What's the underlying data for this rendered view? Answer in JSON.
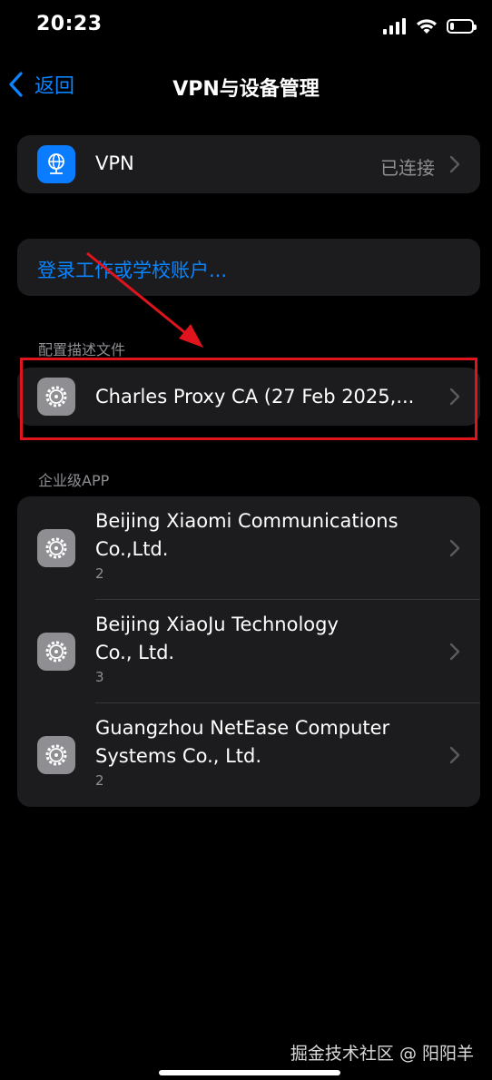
{
  "status_bar": {
    "time": "20:23",
    "battery_level": 0.2
  },
  "nav": {
    "back_label": "返回",
    "title": "VPN与设备管理"
  },
  "vpn_row": {
    "label": "VPN",
    "value": "已连接",
    "icon": "vpn-globe-icon"
  },
  "account_row": {
    "label": "登录工作或学校账户..."
  },
  "profiles_section": {
    "header": "配置描述文件",
    "items": [
      {
        "label": "Charles Proxy CA (27 Feb 2025,...",
        "icon": "settings-gear-icon"
      }
    ]
  },
  "enterprise_section": {
    "header": "企业级APP",
    "items": [
      {
        "name_line1": "Beijing Xiaomi Communications",
        "name_line2": "Co.,Ltd.",
        "count": "2"
      },
      {
        "name_line1": "Beijing XiaoJu Technology",
        "name_line2": "Co., Ltd.",
        "count": "3"
      },
      {
        "name_line1": "Guangzhou NetEase Computer",
        "name_line2": "Systems Co., Ltd.",
        "count": "2"
      }
    ]
  },
  "watermark": "掘金技术社区 @ 阳阳羊",
  "colors": {
    "background": "#000000",
    "group_background": "#1c1c1e",
    "accent_blue": "#0a84ff",
    "secondary_text": "#8e8e93",
    "annotation_red": "#e0141c",
    "settings_icon_gray": "#8e8e93"
  }
}
